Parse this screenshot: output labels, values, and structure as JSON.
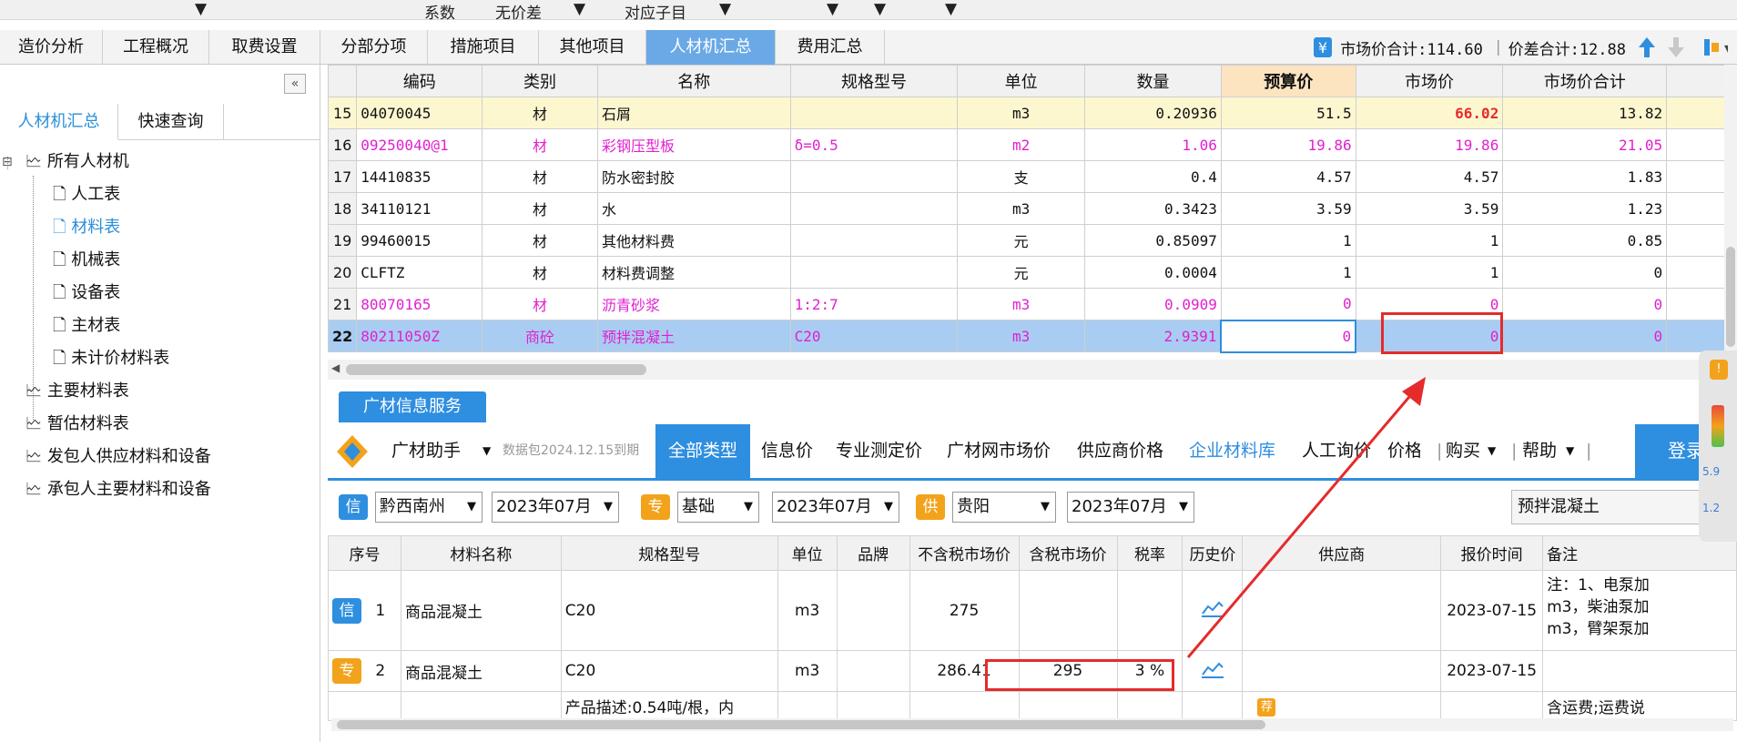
{
  "topstrip": {
    "items": [
      "系数",
      "无价差",
      "对应子目"
    ]
  },
  "tabs": [
    "造价分析",
    "工程概况",
    "取费设置",
    "分部分项",
    "措施项目",
    "其他项目",
    "人材机汇总",
    "费用汇总"
  ],
  "active_tab": "人材机汇总",
  "summary": {
    "market_total_label": "市场价合计:114.60",
    "diff_total_label": "价差合计:12.88"
  },
  "left": {
    "tabs": [
      "人材机汇总",
      "快速查询"
    ],
    "tree": {
      "root": "所有人材机",
      "children": [
        "人工表",
        "材料表",
        "机械表",
        "设备表",
        "主材表",
        "未计价材料表"
      ],
      "others": [
        "主要材料表",
        "暂估材料表",
        "发包人供应材料和设备",
        "承包人主要材料和设备"
      ]
    }
  },
  "grid": {
    "headers": [
      "编码",
      "类别",
      "名称",
      "规格型号",
      "单位",
      "数量",
      "预算价",
      "市场价",
      "市场价合计"
    ],
    "rows": [
      {
        "no": "15",
        "code": "04070045",
        "type": "材",
        "name": "石屑",
        "spec": "",
        "unit": "m3",
        "qty": "0.20936",
        "budget": "51.5",
        "market": "66.02",
        "total": "13.82"
      },
      {
        "no": "16",
        "code": "09250040@1",
        "type": "材",
        "name": "彩钢压型板",
        "spec": "δ=0.5",
        "unit": "m2",
        "qty": "1.06",
        "budget": "19.86",
        "market": "19.86",
        "total": "21.05"
      },
      {
        "no": "17",
        "code": "14410835",
        "type": "材",
        "name": "防水密封胶",
        "spec": "",
        "unit": "支",
        "qty": "0.4",
        "budget": "4.57",
        "market": "4.57",
        "total": "1.83"
      },
      {
        "no": "18",
        "code": "34110121",
        "type": "材",
        "name": "水",
        "spec": "",
        "unit": "m3",
        "qty": "0.3423",
        "budget": "3.59",
        "market": "3.59",
        "total": "1.23"
      },
      {
        "no": "19",
        "code": "99460015",
        "type": "材",
        "name": "其他材料费",
        "spec": "",
        "unit": "元",
        "qty": "0.85097",
        "budget": "1",
        "market": "1",
        "total": "0.85"
      },
      {
        "no": "20",
        "code": "CLFTZ",
        "type": "材",
        "name": "材料费调整",
        "spec": "",
        "unit": "元",
        "qty": "0.0004",
        "budget": "1",
        "market": "1",
        "total": "0"
      },
      {
        "no": "21",
        "code": "80070165",
        "type": "材",
        "name": "沥青砂浆",
        "spec": "1:2:7",
        "unit": "m3",
        "qty": "0.0909",
        "budget": "0",
        "market": "0",
        "total": "0"
      },
      {
        "no": "22",
        "code": "80211050Z",
        "type": "商砼",
        "name": "预拌混凝土",
        "spec": "C20",
        "unit": "m3",
        "qty": "2.9391",
        "budget": "0",
        "market": "0",
        "total": "0"
      }
    ]
  },
  "service_tab": "广材信息服务",
  "gc": {
    "assistant": "广材助手",
    "package": "数据包2024.12.15到期",
    "menu": [
      "全部类型",
      "信息价",
      "专业测定价",
      "广材网市场价",
      "供应商价格",
      "企业材料库",
      "人工询价",
      "价格"
    ],
    "buy": "购买",
    "help": "帮助",
    "login": "登录"
  },
  "filters": {
    "xin_badge": "信",
    "xin_region": "黔西南州",
    "xin_month": "2023年07月",
    "zhuan_badge": "专",
    "zhuan_type": "基础",
    "zhuan_month": "2023年07月",
    "gong_badge": "供",
    "gong_region": "贵阳",
    "gong_month": "2023年07月",
    "search": "预拌混凝土"
  },
  "bottom_table": {
    "headers": [
      "序号",
      "材料名称",
      "规格型号",
      "单位",
      "品牌",
      "不含税市场价",
      "含税市场价",
      "税率",
      "历史价",
      "供应商",
      "报价时间",
      "备注"
    ],
    "rows": [
      {
        "badge": "信",
        "no": "1",
        "name": "商品混凝土",
        "spec": "C20",
        "unit": "m3",
        "brand": "",
        "price_ex": "275",
        "price_in": "",
        "tax": "",
        "date": "2023-07-15",
        "note1": "注：1、电泵加",
        "note2": "m3，柴油泵加",
        "note3": "m3，臂架泵加"
      },
      {
        "badge": "专",
        "no": "2",
        "name": "商品混凝土",
        "spec": "C20",
        "unit": "m3",
        "brand": "",
        "price_ex": "286.41",
        "price_in": "295",
        "tax": "3 %",
        "date": "2023-07-15",
        "note1": ""
      },
      {
        "desc": "产品描述:0.54吨/根，内",
        "rec": "荐",
        "note": "含运费;运费说"
      }
    ]
  },
  "side_numbers": [
    "5.9",
    "1.2"
  ]
}
